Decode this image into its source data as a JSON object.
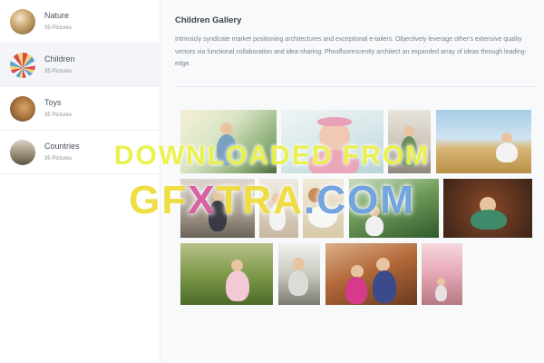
{
  "sidebar": {
    "categories": [
      {
        "name": "Nature",
        "count": "35 Pictures",
        "active": false
      },
      {
        "name": "Children",
        "count": "35 Pictures",
        "active": true
      },
      {
        "name": "Toys",
        "count": "35 Pictures",
        "active": false
      },
      {
        "name": "Countries",
        "count": "35 Pictures",
        "active": false
      }
    ]
  },
  "gallery": {
    "title": "Children Gallery",
    "description": "Intrinsicly syndicate market positioning architectures and exceptional e-tailers. Objectively leverage other's extensive quality vectors via functional collaboration and idea-sharing. Phosfluorescently architect an expanded array of ideas through leading-edge."
  },
  "watermark": {
    "line1": "DOWNLOADED FROM",
    "line2_a": "GF",
    "line2_b": "X",
    "line2_c": "TRA",
    "line2_d": ".COM"
  }
}
